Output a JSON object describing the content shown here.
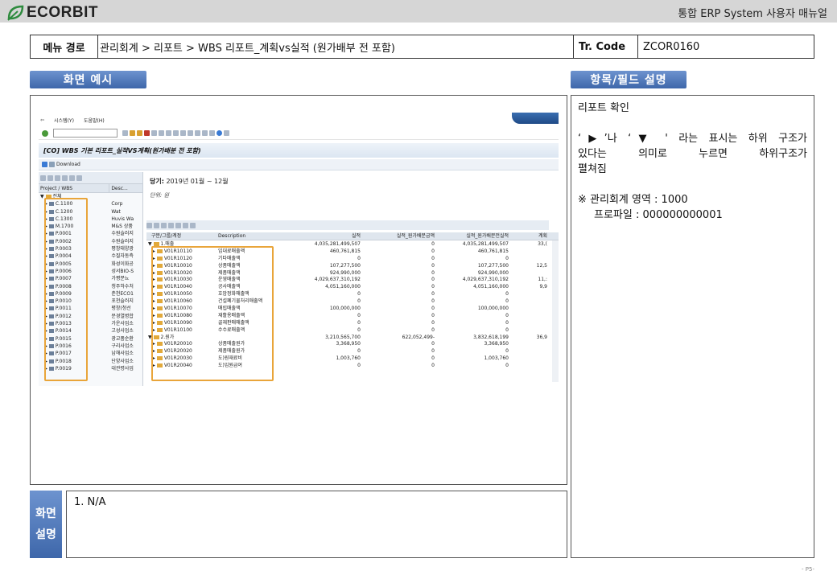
{
  "header": {
    "logo_text": "ECORBIT",
    "title": "통합 ERP System 사용자 매뉴얼"
  },
  "menu_path": {
    "label": "메뉴 경로",
    "value": "관리회계 > 리포트 > WBS 리포트_계획vs실적 (원가배부 전 포함)",
    "tcode_label": "Tr. Code",
    "tcode_value": "ZCOR0160"
  },
  "sections": {
    "screen_example": "화면 예시",
    "field_desc": "항목/필드 설명"
  },
  "right_panel": {
    "line1": "리포트 확인",
    "line2a": "‘▶’나 ‘▼ ' 라는 표시는 하위 구조가",
    "line2b": "있다는 의미로 누르면 하위구조가",
    "line2c": "펼쳐짐",
    "line3": "※ 관리회계 영역 : 1000",
    "line4": "프로파일 : 000000000001"
  },
  "description": {
    "tab_line1": "화면",
    "tab_line2": "설명",
    "item1": "1.   N/A"
  },
  "page_number": "- P5-",
  "sap": {
    "menu_system": "시스템(Y)",
    "menu_help": "도움말(H)",
    "title": "[CO] WBS 기본 리포트_실적VS계획(원가배분 전 포함)",
    "download": "Download",
    "left_headers": [
      "Project / WBS",
      "Desc..."
    ],
    "left_root": "전체",
    "left_rows": [
      {
        "code": "C.1100",
        "desc": "Corp"
      },
      {
        "code": "C.1200",
        "desc": "Wat"
      },
      {
        "code": "C.1300",
        "desc": "Huvis Wa"
      },
      {
        "code": "M.1700",
        "desc": "M&S 상품"
      },
      {
        "code": "P.0001",
        "desc": "수원슬러지"
      },
      {
        "code": "P.0002",
        "desc": "수원슬러지"
      },
      {
        "code": "P.0003",
        "desc": "평창태양광"
      },
      {
        "code": "P.0004",
        "desc": "수질자동측"
      },
      {
        "code": "P.0005",
        "desc": "화성이화공"
      },
      {
        "code": "P.0006",
        "desc": "성서BIO-S"
      },
      {
        "code": "P.0007",
        "desc": "가평분뇨"
      },
      {
        "code": "P.0008",
        "desc": "청주하수처"
      },
      {
        "code": "P.0009",
        "desc": "춘천ECO1"
      },
      {
        "code": "P.0010",
        "desc": "포천슬러지"
      },
      {
        "code": "P.0011",
        "desc": "평창(청선"
      },
      {
        "code": "P.0012",
        "desc": "문경열병합"
      },
      {
        "code": "P.0013",
        "desc": "가운사업소"
      },
      {
        "code": "P.0014",
        "desc": "고성사업소"
      },
      {
        "code": "P.0015",
        "desc": "광교품순환"
      },
      {
        "code": "P.0016",
        "desc": "구리사업소"
      },
      {
        "code": "P.0017",
        "desc": "남해사업소"
      },
      {
        "code": "P.0018",
        "desc": "단양사업소"
      },
      {
        "code": "P.0019",
        "desc": "대관령사업"
      }
    ],
    "period_label": "당기:",
    "period_value": "2019년 01월 ~ 12월",
    "unit": "단위: 원",
    "grid_headers": [
      "구분/그룹/계정",
      "Description",
      "실적",
      "실적_원가배분금액",
      "실적_원가배분전실적",
      "계획"
    ],
    "grid_rows": [
      {
        "code": "1.매출",
        "desc": "",
        "v1": "4,035,281,499,507",
        "v2": "0",
        "v3": "4,035,281,499,507",
        "v4": "33,("
      },
      {
        "code": "V01R10110",
        "desc": "임대료매출액",
        "v1": "460,761,815",
        "v2": "0",
        "v3": "460,761,815",
        "v4": ""
      },
      {
        "code": "V01R10120",
        "desc": "기타매출액",
        "v1": "0",
        "v2": "0",
        "v3": "0",
        "v4": ""
      },
      {
        "code": "V01R10010",
        "desc": "상품매출액",
        "v1": "107,277,500",
        "v2": "0",
        "v3": "107,277,500",
        "v4": "12,5"
      },
      {
        "code": "V01R10020",
        "desc": "제품매출액",
        "v1": "924,990,000",
        "v2": "0",
        "v3": "924,990,000",
        "v4": ""
      },
      {
        "code": "V01R10030",
        "desc": "운영매출액",
        "v1": "4,029,637,310,192",
        "v2": "0",
        "v3": "4,029,637,310,192",
        "v4": "11,:"
      },
      {
        "code": "V01R10040",
        "desc": "공사매출액",
        "v1": "4,051,160,000",
        "v2": "0",
        "v3": "4,051,160,000",
        "v4": "9,9"
      },
      {
        "code": "V01R10050",
        "desc": "호암정화매출액",
        "v1": "0",
        "v2": "0",
        "v3": "0",
        "v4": ""
      },
      {
        "code": "V01R10060",
        "desc": "건설폐기물처리매출액",
        "v1": "0",
        "v2": "0",
        "v3": "0",
        "v4": ""
      },
      {
        "code": "V01R10070",
        "desc": "매립매출액",
        "v1": "100,000,000",
        "v2": "0",
        "v3": "100,000,000",
        "v4": ""
      },
      {
        "code": "V01R10080",
        "desc": "재활용매출액",
        "v1": "0",
        "v2": "0",
        "v3": "0",
        "v4": ""
      },
      {
        "code": "V01R10090",
        "desc": "골재판매매출액",
        "v1": "0",
        "v2": "0",
        "v3": "0",
        "v4": ""
      },
      {
        "code": "V01R10100",
        "desc": "수수료매출액",
        "v1": "0",
        "v2": "0",
        "v3": "0",
        "v4": ""
      },
      {
        "code": "2.원가",
        "desc": "",
        "v1": "3,210,565,700",
        "v2": "622,052,499-",
        "v3": "3,832,618,199",
        "v4": "36,9"
      },
      {
        "code": "V01R20010",
        "desc": "상품매출원가",
        "v1": "3,368,950",
        "v2": "0",
        "v3": "3,368,950",
        "v4": ""
      },
      {
        "code": "V01R20020",
        "desc": "제품매출원가",
        "v1": "0",
        "v2": "0",
        "v3": "0",
        "v4": ""
      },
      {
        "code": "V01R20030",
        "desc": "도)원재료비",
        "v1": "1,003,760",
        "v2": "0",
        "v3": "1,003,760",
        "v4": ""
      },
      {
        "code": "V01R20040",
        "desc": "도)임원급여",
        "v1": "0",
        "v2": "0",
        "v3": "0",
        "v4": ""
      }
    ]
  }
}
